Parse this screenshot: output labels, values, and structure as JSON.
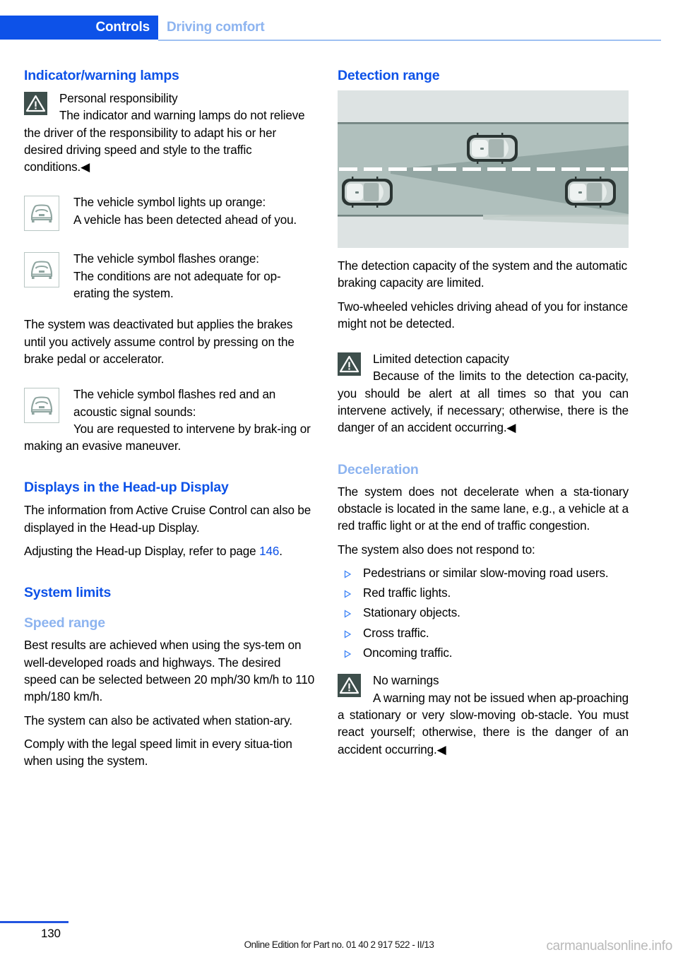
{
  "header": {
    "chapter": "Controls",
    "section": "Driving comfort"
  },
  "left_column": {
    "heading_indicator_lamps": "Indicator/warning lamps",
    "warning_personal_responsibility": {
      "icon": "warning-triangle-icon",
      "title": "Personal responsibility",
      "text": "The indicator and warning lamps do not relieve the driver of the responsibility to adapt his or her desired driving speed and style to the traffic conditions.◀"
    },
    "symbol_orange_steady": {
      "icon": "car-front-symbol-icon",
      "title": "The vehicle symbol lights up orange:",
      "text": "A vehicle has been detected ahead of you."
    },
    "symbol_orange_flashing": {
      "icon": "car-front-symbol-icon",
      "title": "The vehicle symbol flashes orange:",
      "text": "The conditions are not adequate for op‐erating the system."
    },
    "paragraph_deactivated": "The system was deactivated but applies the brakes until you actively assume control by pressing on the brake pedal or accelerator.",
    "symbol_red_flashing": {
      "icon": "car-front-symbol-icon",
      "title": "The vehicle symbol flashes red and an acoustic signal sounds:",
      "text": "You are requested to intervene by brak‐ing or making an evasive maneuver."
    },
    "heading_hud": "Displays in the Head-up Display",
    "paragraph_hud_info": "The information from Active Cruise Control can also be displayed in the Head-up Display.",
    "paragraph_hud_adjust_pre": "Adjusting the Head-up Display, refer to page ",
    "paragraph_hud_adjust_page": "146",
    "paragraph_hud_adjust_post": ".",
    "heading_system_limits": "System limits",
    "heading_speed_range": "Speed range",
    "paragraph_best_results": "Best results are achieved when using the sys‐tem on well-developed roads and highways. The desired speed can be selected between 20 mph/30 km/h to 110 mph/180 km/h.",
    "paragraph_stationary": "The system can also be activated when station‐ary.",
    "paragraph_comply": "Comply with the legal speed limit in every situa‐tion when using the system."
  },
  "right_column": {
    "heading_detection_range": "Detection range",
    "figure": {
      "name": "detection-range-diagram",
      "description": "Top-down road diagram showing own vehicle at left with radar detection cone extending ahead, a vehicle ahead in adjacent lane and a vehicle ahead in same lane"
    },
    "paragraph_capacity": "The detection capacity of the system and the automatic braking capacity are limited.",
    "paragraph_two_wheeled": "Two-wheeled vehicles driving ahead of you for instance might not be detected.",
    "warning_limited_detection": {
      "icon": "warning-triangle-icon",
      "title": "Limited detection capacity",
      "text": "Because of the limits to the detection ca‐pacity, you should be alert at all times so that you can intervene actively, if necessary; otherwise, there is the danger of an accident occurring.◀"
    },
    "heading_deceleration": "Deceleration",
    "paragraph_stationary_obstacle": "The system does not decelerate when a sta‐tionary obstacle is located in the same lane, e.g., a vehicle at a red traffic light or at the end of traffic congestion.",
    "paragraph_no_respond": "The system also does not respond to:",
    "bullets": [
      "Pedestrians or similar slow-moving road users.",
      "Red traffic lights.",
      "Stationary objects.",
      "Cross traffic.",
      "Oncoming traffic."
    ],
    "warning_no_warnings": {
      "icon": "warning-triangle-icon",
      "title": "No warnings",
      "text": "A warning may not be issued when ap‐proaching a stationary or very slow-moving ob‐stacle. You must react yourself; otherwise, there is the danger of an accident occurring.◀"
    }
  },
  "footer": {
    "page_number": "130",
    "edition": "Online Edition for Part no. 01 40 2 917 522 - II/13",
    "watermark": "carmanualsonline.info"
  },
  "colors": {
    "brand_blue": "#0d52e8",
    "light_blue": "#8db4f0",
    "warning_icon_bg": "#3e4f4c",
    "symbol_gray_green": "#8fa5a0",
    "figure_bg": "#dde3e3",
    "road_gray": "#b0c0bd"
  }
}
